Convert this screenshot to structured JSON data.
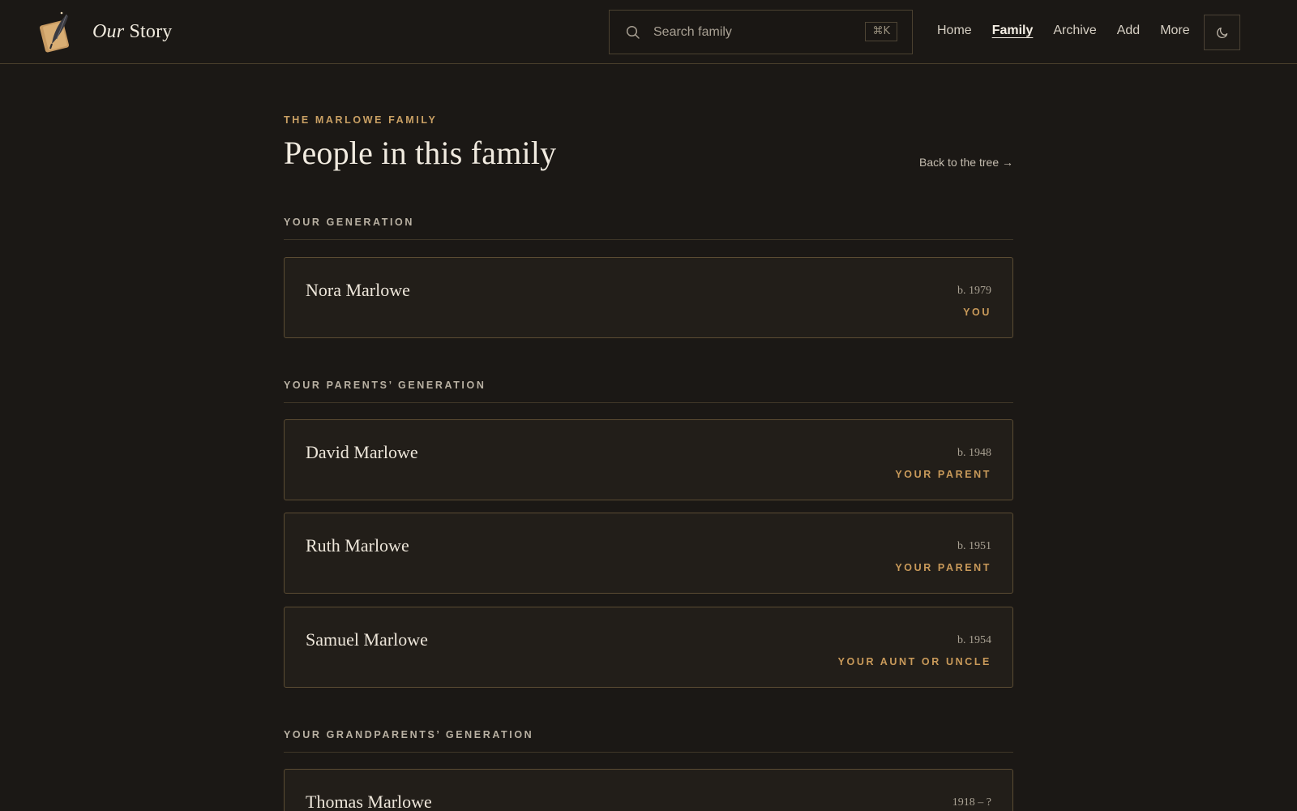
{
  "header": {
    "brand_name_italic": "Our",
    "brand_name_rest": " Story",
    "search_placeholder": "Search family",
    "search_shortcut": "⌘K",
    "nav": [
      {
        "label": "Home"
      },
      {
        "label": "Family",
        "active": true
      },
      {
        "label": "Archive"
      },
      {
        "label": "Add"
      },
      {
        "label": "More"
      }
    ],
    "theme_icon": "moon-icon"
  },
  "page": {
    "eyebrow": "THE MARLOWE FAMILY",
    "title": "People in this family",
    "back_link": "Back to the tree →"
  },
  "generations": [
    {
      "label": "YOUR GENERATION",
      "people": [
        {
          "name": "Nora Marlowe",
          "years": "b. 1979",
          "relation": "YOU"
        }
      ]
    },
    {
      "label": "YOUR PARENTS’ GENERATION",
      "people": [
        {
          "name": "David Marlowe",
          "years": "b. 1948",
          "relation": "YOUR PARENT"
        },
        {
          "name": "Ruth Marlowe",
          "years": "b. 1951",
          "relation": "YOUR PARENT"
        },
        {
          "name": "Samuel Marlowe",
          "years": "b. 1954",
          "relation": "YOUR AUNT OR UNCLE"
        }
      ]
    },
    {
      "label": "YOUR GRANDPARENTS’ GENERATION",
      "people": [
        {
          "name": "Thomas Marlowe",
          "years": "1918 – ?",
          "relation": ""
        }
      ]
    }
  ],
  "colors": {
    "background": "#1b1815",
    "accent": "#c99a5a",
    "card_border": "#5b4c33"
  }
}
